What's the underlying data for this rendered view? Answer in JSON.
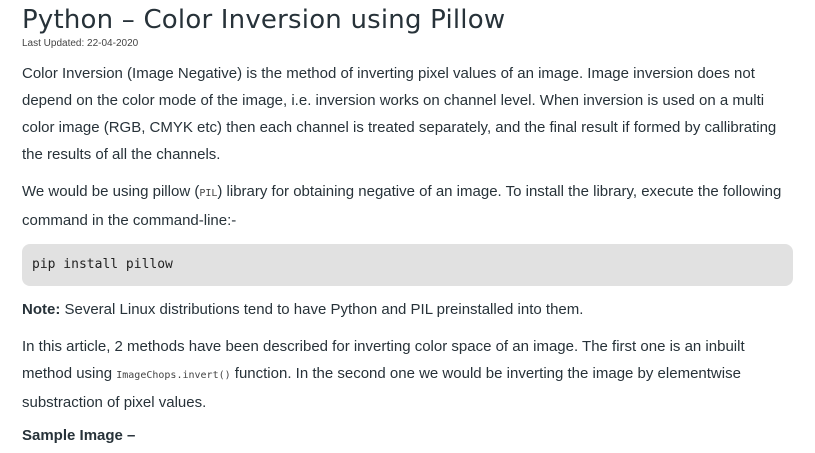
{
  "article": {
    "title": "Python – Color Inversion using Pillow",
    "last_updated": "Last Updated: 22-04-2020",
    "para1": "Color Inversion (Image Negative) is the method of inverting pixel values of an image. Image inversion does not depend on the color mode of the image, i.e. inversion works on channel level. When inversion is used on a multi color image (RGB, CMYK etc) then each channel is treated separately, and the final result if formed by callibrating the results of all the channels.",
    "para2": {
      "before": "We would be using pillow (",
      "code": "PIL",
      "after": ") library for obtaining negative of an image. To install the library, execute the following command in the command-line:-"
    },
    "code_block": "pip install pillow",
    "note": {
      "label": "Note:",
      "text": " Several Linux distributions tend to have Python and PIL preinstalled into them."
    },
    "para4": {
      "before": "In this article, 2 methods have been described for inverting color space of an image. The first one is an inbuilt method using ",
      "code": "ImageChops.invert()",
      "after": " function. In the second one we would be inverting the image by elementwise substraction of pixel values."
    },
    "sample_heading": "Sample Image –"
  }
}
